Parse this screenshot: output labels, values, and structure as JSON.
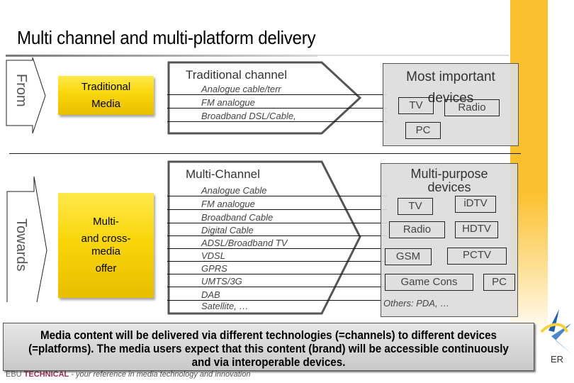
{
  "title": "Multi channel and multi-platform delivery",
  "colors": {
    "brand_orange": "#fbc02d",
    "media_box_yellow": "#f9d60a",
    "panel_gray": "#dcdcdc",
    "footer_accent": "#a0305a"
  },
  "rows": {
    "from": {
      "side_label": "From",
      "media_box": [
        "Traditional",
        "Media"
      ],
      "channel": {
        "title": "Traditional channel",
        "items": [
          "Analogue cable/terr",
          "FM analogue",
          "Broadband DSL/Cable,"
        ]
      },
      "devices": {
        "title": "Most important devices",
        "items": [
          "TV",
          "Radio",
          "PC"
        ]
      }
    },
    "towards": {
      "side_label": "Towards",
      "media_box": [
        "Multi-",
        "and cross-",
        "media",
        "offer"
      ],
      "channel": {
        "title": "Multi-Channel",
        "items": [
          "Analogue Cable",
          "FM analogue",
          "Broadband Cable",
          "Digital Cable",
          "ADSL/Broadband TV",
          "VDSL",
          "GPRS",
          "UMTS/3G",
          "DAB",
          "Satellite, …"
        ]
      },
      "devices": {
        "title_line1": "Multi-purpose",
        "title_line2": "devices",
        "items": [
          "TV",
          "iDTV",
          "Radio",
          "HDTV",
          "GSM",
          "PCTV",
          "Game Cons",
          "PC"
        ],
        "others": "Others: PDA, …"
      }
    }
  },
  "summary": "Media content will be delivered via different technologies (=channels) to different devices (=platforms). The media users expect that this content (brand) will be accessible continuously and via interoperable devices.",
  "footer": {
    "brand_ebu": "EBU",
    "brand_technical": "TECHNICAL",
    "tagline": " - your reference in media technology and innovation"
  },
  "logo": {
    "icon": "star-logo-icon",
    "text_fragment": "ER"
  }
}
